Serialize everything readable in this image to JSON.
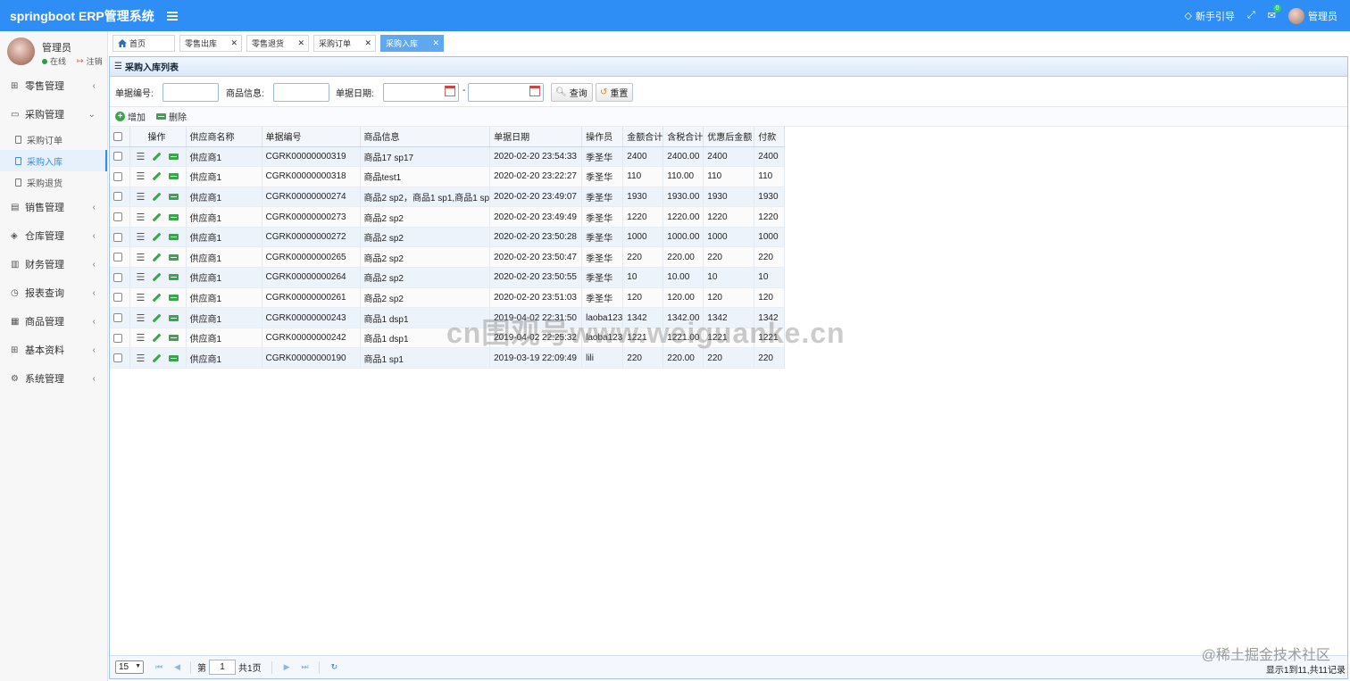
{
  "app": {
    "title": "springboot ERP管理系统",
    "guide_label": "新手引导",
    "mail_badge": "0",
    "user_label": "管理员"
  },
  "sidebar": {
    "user_name": "管理员",
    "status": "在线",
    "logout": "注销",
    "menu": [
      {
        "label": "零售管理",
        "icon": "gift-icon"
      },
      {
        "label": "采购管理",
        "icon": "monitor-icon",
        "expanded": true
      },
      {
        "label": "销售管理",
        "icon": "briefcase-icon"
      },
      {
        "label": "仓库管理",
        "icon": "layers-icon"
      },
      {
        "label": "财务管理",
        "icon": "book-icon"
      },
      {
        "label": "报表查询",
        "icon": "clock-icon"
      },
      {
        "label": "商品管理",
        "icon": "grid-icon"
      },
      {
        "label": "基本资料",
        "icon": "apps-icon"
      },
      {
        "label": "系统管理",
        "icon": "gear-icon"
      }
    ],
    "submenu": [
      {
        "label": "采购订单",
        "active": false
      },
      {
        "label": "采购入库",
        "active": true
      },
      {
        "label": "采购退货",
        "active": false
      }
    ]
  },
  "tabs": [
    {
      "label": "首页",
      "active": false
    },
    {
      "label": "零售出库",
      "active": false
    },
    {
      "label": "零售退货",
      "active": false
    },
    {
      "label": "采购订单",
      "active": false
    },
    {
      "label": "采购入库",
      "active": true
    }
  ],
  "panel": {
    "title": "采购入库列表",
    "search": {
      "number_label": "单据编号:",
      "number_value": "",
      "goods_label": "商品信息:",
      "goods_value": "",
      "date_label": "单据日期:",
      "date_from": "",
      "date_sep": "-",
      "date_to": "",
      "query_button": "查询",
      "reset_button": "重置"
    },
    "toolbar": {
      "add": "增加",
      "delete": "删除"
    },
    "columns": [
      "操作",
      "供应商名称",
      "单据编号",
      "商品信息",
      "单据日期",
      "操作员",
      "金额合计",
      "含税合计",
      "优惠后金额",
      "付款"
    ],
    "rows": [
      [
        "供应商1",
        "CGRK00000000319",
        "商品17 sp17",
        "2020-02-20 23:54:33",
        "季圣华",
        "2400",
        "2400.00",
        "2400",
        "2400"
      ],
      [
        "供应商1",
        "CGRK00000000318",
        "商品test1",
        "2020-02-20 23:22:27",
        "季圣华",
        "110",
        "110.00",
        "110",
        "110"
      ],
      [
        "供应商1",
        "CGRK00000000274",
        "商品2 sp2，商品1 sp1,商品1 sp",
        "2020-02-20 23:49:07",
        "季圣华",
        "1930",
        "1930.00",
        "1930",
        "1930"
      ],
      [
        "供应商1",
        "CGRK00000000273",
        "商品2 sp2",
        "2020-02-20 23:49:49",
        "季圣华",
        "1220",
        "1220.00",
        "1220",
        "1220"
      ],
      [
        "供应商1",
        "CGRK00000000272",
        "商品2 sp2",
        "2020-02-20 23:50:28",
        "季圣华",
        "1000",
        "1000.00",
        "1000",
        "1000"
      ],
      [
        "供应商1",
        "CGRK00000000265",
        "商品2 sp2",
        "2020-02-20 23:50:47",
        "季圣华",
        "220",
        "220.00",
        "220",
        "220"
      ],
      [
        "供应商1",
        "CGRK00000000264",
        "商品2 sp2",
        "2020-02-20 23:50:55",
        "季圣华",
        "10",
        "10.00",
        "10",
        "10"
      ],
      [
        "供应商1",
        "CGRK00000000261",
        "商品2 sp2",
        "2020-02-20 23:51:03",
        "季圣华",
        "120",
        "120.00",
        "120",
        "120"
      ],
      [
        "供应商1",
        "CGRK00000000243",
        "商品1 dsp1",
        "2019-04-02 22:31:50",
        "laoba123",
        "1342",
        "1342.00",
        "1342",
        "1342"
      ],
      [
        "供应商1",
        "CGRK00000000242",
        "商品1 dsp1",
        "2019-04-02 22:25:32",
        "laoba123",
        "1221",
        "1221.00",
        "1221",
        "1221"
      ],
      [
        "供应商1",
        "CGRK00000000190",
        "商品1 sp1",
        "2019-03-19 22:09:49",
        "lili",
        "220",
        "220.00",
        "220",
        "220"
      ]
    ],
    "pager": {
      "page_size": "15",
      "page_prefix": "第",
      "page_value": "1",
      "page_suffix": "共1页",
      "info": "显示1到11,共11记录"
    }
  },
  "overlays": {
    "watermark": "cn围观号www.weiguanke.cn",
    "juejin": "@稀土掘金技术社区"
  },
  "colors": {
    "topbar": "#2e8ef5",
    "active_tab": "#5fa8ef",
    "green_icon": "#3aa54c"
  }
}
